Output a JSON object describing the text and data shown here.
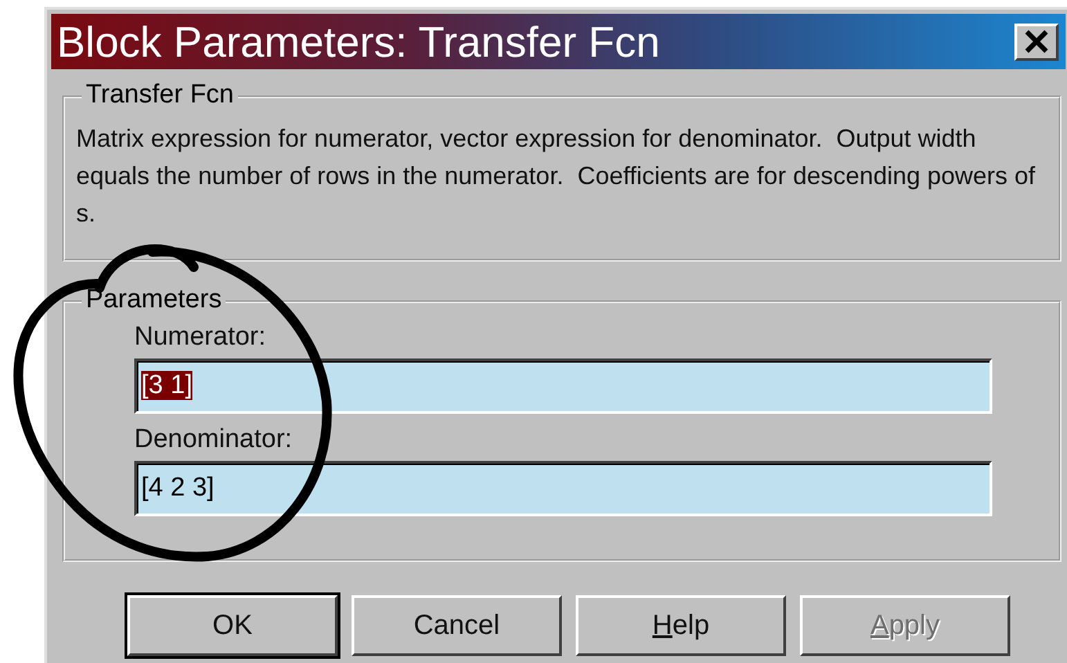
{
  "window": {
    "title": "Block Parameters: Transfer Fcn"
  },
  "description_group": {
    "title": "Transfer Fcn",
    "text": "Matrix expression for numerator, vector expression for denominator.  Output width equals the number of rows in the numerator.  Coefficients are for descending powers of s."
  },
  "parameters_group": {
    "title": "Parameters",
    "fields": [
      {
        "label": "Numerator:",
        "value": "[3 1]",
        "selected": true
      },
      {
        "label": "Denominator:",
        "value": "[4 2 3]",
        "selected": false
      }
    ]
  },
  "buttons": [
    {
      "rest": "OK",
      "default": true,
      "disabled": false
    },
    {
      "rest": "Cancel",
      "default": false,
      "disabled": false
    },
    {
      "underlined": "H",
      "rest": "elp",
      "default": false,
      "disabled": false
    },
    {
      "underlined": "A",
      "rest": "pply",
      "default": false,
      "disabled": true
    }
  ]
}
